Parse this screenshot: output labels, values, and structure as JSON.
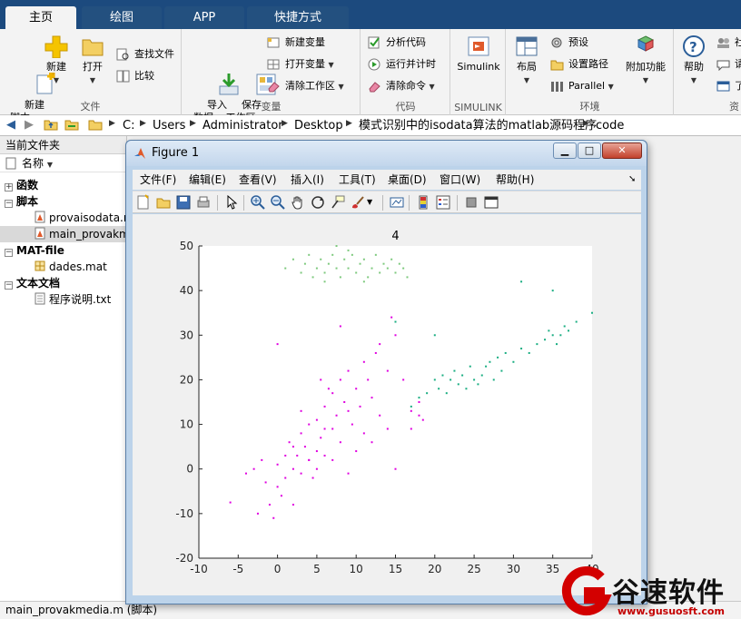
{
  "ribbon": {
    "tabs": [
      {
        "label": "主页",
        "active": true
      },
      {
        "label": "绘图",
        "active": false
      },
      {
        "label": "APP",
        "active": false
      },
      {
        "label": "快捷方式",
        "active": false
      }
    ],
    "groups": {
      "file": {
        "title": "文件",
        "new_script": "新建\n脚本",
        "new": "新建",
        "open": "打开",
        "find_files": "查找文件",
        "compare": "比较"
      },
      "variable": {
        "title": "变量",
        "import_data": "导入\n数据",
        "save_workspace": "保存\n工作区",
        "new_variable": "新建变量",
        "open_variable": "打开变量",
        "clear_workspace": "清除工作区"
      },
      "code": {
        "title": "代码",
        "analyze_code": "分析代码",
        "run_and_time": "运行并计时",
        "clear_commands": "清除命令"
      },
      "simulink": {
        "title": "SIMULINK",
        "label": "Simulink"
      },
      "environment": {
        "title": "环境",
        "layout": "布局",
        "preferences": "预设",
        "set_path": "设置路径",
        "parallel": "Parallel",
        "addons": "附加功能"
      },
      "resources": {
        "title": "资",
        "help": "帮助",
        "community": "社",
        "request": "请",
        "learn": "了"
      }
    }
  },
  "address": {
    "path": [
      "C:",
      "Users",
      "Administrator",
      "Desktop",
      "模式识别中的isodata算法的matlab源码程序",
      "code"
    ]
  },
  "file_browser": {
    "title": "当前文件夹",
    "column_name": "名称",
    "groups": [
      {
        "label": "函数",
        "expanded": false,
        "items": []
      },
      {
        "label": "脚本",
        "expanded": true,
        "items": [
          {
            "name": "provaisodata.m",
            "type": "m-file",
            "selected": false
          },
          {
            "name": "main_provakmedia.m",
            "type": "m-file",
            "selected": true
          }
        ]
      },
      {
        "label": "MAT-file",
        "expanded": true,
        "items": [
          {
            "name": "dades.mat",
            "type": "mat-file",
            "selected": false
          }
        ]
      },
      {
        "label": "文本文档",
        "expanded": true,
        "items": [
          {
            "name": "程序说明.txt",
            "type": "txt-file",
            "selected": false
          }
        ]
      }
    ]
  },
  "statusbar": {
    "text": "main_provakmedia.m  (脚本)"
  },
  "figure": {
    "title": "Figure 1",
    "menu": [
      "文件(F)",
      "编辑(E)",
      "查看(V)",
      "插入(I)",
      "工具(T)",
      "桌面(D)",
      "窗口(W)",
      "帮助(H)"
    ],
    "toolbar_icons": [
      "new-figure-icon",
      "open-file-icon",
      "save-icon",
      "print-icon",
      "pointer-icon",
      "zoom-in-icon",
      "zoom-out-icon",
      "pan-hand-icon",
      "rotate-3d-icon",
      "data-cursor-icon",
      "brush-icon",
      "link-plot-icon",
      "colorbar-icon",
      "legend-icon",
      "hide-plot-tools-icon",
      "show-plot-tools-icon"
    ]
  },
  "chart_data": {
    "type": "scatter",
    "title": "4",
    "xlabel": "",
    "ylabel": "",
    "xlim": [
      -10,
      40
    ],
    "ylim": [
      -20,
      50
    ],
    "xticks": [
      -10,
      -5,
      0,
      5,
      10,
      15,
      20,
      25,
      30,
      35,
      40
    ],
    "yticks": [
      -20,
      -10,
      0,
      10,
      20,
      30,
      40,
      50
    ],
    "grid": false,
    "series": [
      {
        "color": "#e000e0",
        "points": [
          [
            -6,
            -7.5
          ],
          [
            -4,
            -1
          ],
          [
            -3,
            0
          ],
          [
            -2.5,
            -10
          ],
          [
            -2,
            2
          ],
          [
            -1.5,
            -3
          ],
          [
            -1,
            -8
          ],
          [
            -0.5,
            -11
          ],
          [
            0,
            -4
          ],
          [
            0,
            1
          ],
          [
            0.5,
            -6
          ],
          [
            1,
            3
          ],
          [
            1,
            -2
          ],
          [
            1.5,
            6
          ],
          [
            2,
            0
          ],
          [
            2,
            -8
          ],
          [
            2.5,
            3
          ],
          [
            3,
            8
          ],
          [
            3,
            -1
          ],
          [
            3.5,
            5
          ],
          [
            4,
            10
          ],
          [
            4,
            2
          ],
          [
            4.5,
            -2
          ],
          [
            5,
            11
          ],
          [
            5,
            4
          ],
          [
            5,
            0
          ],
          [
            5.5,
            7
          ],
          [
            6,
            14
          ],
          [
            6,
            3
          ],
          [
            6.5,
            18
          ],
          [
            7,
            9
          ],
          [
            7,
            2
          ],
          [
            7.5,
            12
          ],
          [
            8,
            20
          ],
          [
            8,
            6
          ],
          [
            8.5,
            15
          ],
          [
            9,
            22
          ],
          [
            9,
            -1
          ],
          [
            9.5,
            10
          ],
          [
            10,
            18
          ],
          [
            10,
            4
          ],
          [
            10.5,
            14
          ],
          [
            11,
            24
          ],
          [
            11,
            8
          ],
          [
            11.5,
            20
          ],
          [
            12,
            16
          ],
          [
            12,
            6
          ],
          [
            12.5,
            26
          ],
          [
            13,
            12
          ],
          [
            13,
            28
          ],
          [
            14,
            22
          ],
          [
            14,
            9
          ],
          [
            14.5,
            34
          ],
          [
            15,
            30
          ],
          [
            15,
            0
          ],
          [
            16,
            20
          ],
          [
            17,
            13
          ],
          [
            17,
            9
          ],
          [
            18,
            12
          ],
          [
            18,
            15
          ],
          [
            18.5,
            11
          ],
          [
            0,
            28
          ],
          [
            8,
            32
          ],
          [
            4,
            2
          ],
          [
            3,
            13
          ],
          [
            6,
            9
          ],
          [
            2,
            5
          ],
          [
            7,
            17
          ],
          [
            5.5,
            20
          ],
          [
            9,
            13
          ]
        ]
      },
      {
        "color": "#1aae82",
        "points": [
          [
            17,
            14
          ],
          [
            18,
            16
          ],
          [
            19,
            17
          ],
          [
            20,
            20
          ],
          [
            20.5,
            18
          ],
          [
            21,
            21
          ],
          [
            21.5,
            17
          ],
          [
            22,
            20
          ],
          [
            22.5,
            22
          ],
          [
            23,
            19
          ],
          [
            23.5,
            21
          ],
          [
            24,
            18
          ],
          [
            24.5,
            23
          ],
          [
            25,
            20
          ],
          [
            25.5,
            19
          ],
          [
            26,
            21
          ],
          [
            26.5,
            23
          ],
          [
            27,
            24
          ],
          [
            27.5,
            20
          ],
          [
            28,
            25
          ],
          [
            28.5,
            22
          ],
          [
            29,
            26
          ],
          [
            30,
            24
          ],
          [
            31,
            27
          ],
          [
            32,
            26
          ],
          [
            33,
            28
          ],
          [
            34,
            29
          ],
          [
            34.5,
            31
          ],
          [
            35,
            30
          ],
          [
            35.5,
            28
          ],
          [
            36,
            30
          ],
          [
            36.5,
            32
          ],
          [
            37,
            31
          ],
          [
            38,
            33
          ],
          [
            40,
            35
          ],
          [
            35,
            40
          ],
          [
            31,
            42
          ],
          [
            20,
            30
          ],
          [
            15,
            33
          ]
        ]
      },
      {
        "color": "#7dc97d",
        "points": [
          [
            1,
            45
          ],
          [
            2,
            47
          ],
          [
            3,
            44
          ],
          [
            3.5,
            46
          ],
          [
            4,
            48
          ],
          [
            4.5,
            43
          ],
          [
            5,
            45
          ],
          [
            5.5,
            47
          ],
          [
            6,
            44
          ],
          [
            6.5,
            46
          ],
          [
            7,
            48
          ],
          [
            7.5,
            45
          ],
          [
            8,
            43
          ],
          [
            8.5,
            47
          ],
          [
            9,
            45
          ],
          [
            9.5,
            48
          ],
          [
            10,
            44
          ],
          [
            10.5,
            46
          ],
          [
            11,
            47
          ],
          [
            11.5,
            43
          ],
          [
            12,
            45
          ],
          [
            12.5,
            48
          ],
          [
            13,
            44
          ],
          [
            13.5,
            46
          ],
          [
            14,
            45
          ],
          [
            14.5,
            47
          ],
          [
            15,
            44
          ],
          [
            15.5,
            46
          ],
          [
            16,
            45
          ],
          [
            16.5,
            43
          ],
          [
            7.5,
            50
          ],
          [
            9,
            49
          ],
          [
            6,
            42
          ],
          [
            11,
            42
          ]
        ]
      }
    ]
  },
  "watermark": {
    "brand": "谷速软件",
    "url": "www.gusuosft.com"
  }
}
